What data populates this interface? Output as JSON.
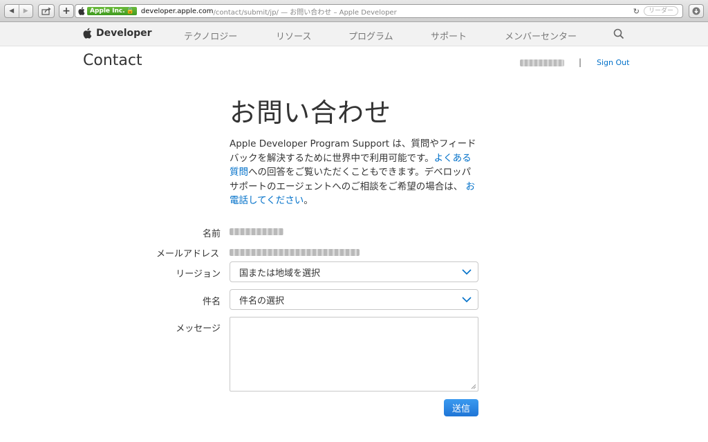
{
  "browser": {
    "ev_label": "Apple Inc.",
    "url_host": "developer.apple.com",
    "url_path": "/contact/submit/jp/ — お問い合わせ – Apple Developer",
    "reader_label": "リーダー"
  },
  "site_nav": {
    "brand": "Developer",
    "items": [
      "テクノロジー",
      "リソース",
      "プログラム",
      "サポート",
      "メンバーセンター"
    ]
  },
  "header": {
    "heading": "Contact",
    "divider": "|",
    "sign_out": "Sign Out"
  },
  "main": {
    "title": "お問い合わせ",
    "intro_part1": "Apple Developer Program Support は、質問やフィードバックを解決するために世界中で利用可能です。",
    "intro_link1": "よくある質問",
    "intro_part2": "への回答をご覧いただくこともできます。デベロッパサポートのエージェントへのご相談をご希望の場合は、",
    "intro_link2": "お電話してください",
    "intro_part3": "。"
  },
  "form": {
    "name_label": "名前",
    "email_label": "メールアドレス",
    "region_label": "リージョン",
    "region_value": "国または地域を選択",
    "subject_label": "件名",
    "subject_value": "件名の選択",
    "message_label": "メッセージ",
    "submit_label": "送信"
  },
  "colors": {
    "link": "#0070c9",
    "submit_button": "#1f75d6"
  }
}
